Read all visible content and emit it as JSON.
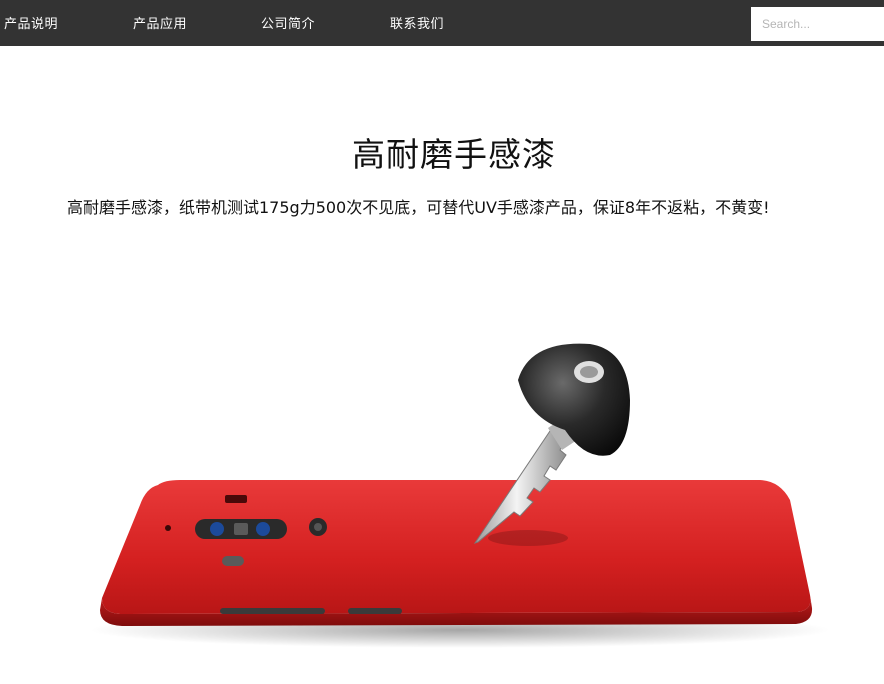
{
  "nav": {
    "items": [
      {
        "label": "产品说明"
      },
      {
        "label": "产品应用"
      },
      {
        "label": "公司简介"
      },
      {
        "label": "联系我们"
      }
    ],
    "search_placeholder": "Search...",
    "background_color": "#333333"
  },
  "main": {
    "title": "高耐磨手感漆",
    "description": "高耐磨手感漆，纸带机测试175g力500次不见底，可替代UV手感漆产品，保证8年不返粘，不黄变!",
    "image": {
      "depicts": "red-phone-case-with-car-key",
      "accent_color": "#d42020"
    }
  }
}
